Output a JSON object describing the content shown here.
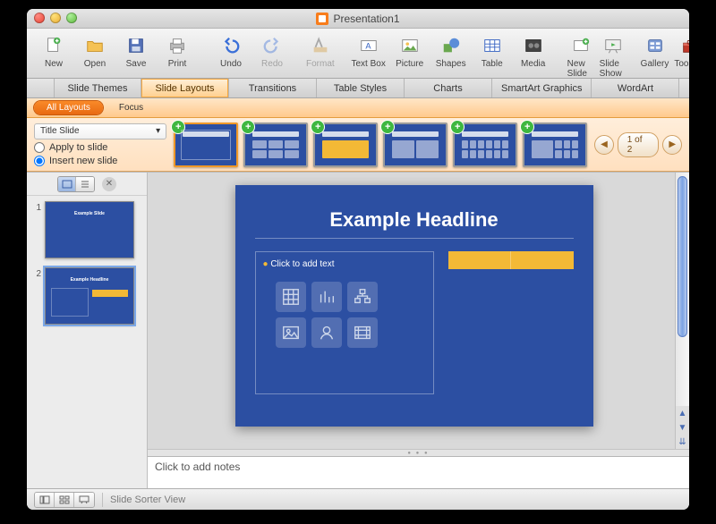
{
  "title": "Presentation1",
  "toolbar": [
    {
      "name": "new",
      "label": "New"
    },
    {
      "name": "open",
      "label": "Open"
    },
    {
      "name": "save",
      "label": "Save"
    },
    {
      "name": "print",
      "label": "Print"
    },
    {
      "name": "undo",
      "label": "Undo"
    },
    {
      "name": "redo",
      "label": "Redo",
      "disabled": true
    },
    {
      "name": "format",
      "label": "Format",
      "disabled": true
    },
    {
      "name": "textbox",
      "label": "Text Box"
    },
    {
      "name": "picture",
      "label": "Picture"
    },
    {
      "name": "shapes",
      "label": "Shapes"
    },
    {
      "name": "table",
      "label": "Table"
    },
    {
      "name": "media",
      "label": "Media"
    },
    {
      "name": "newslide",
      "label": "New Slide"
    },
    {
      "name": "slideshow",
      "label": "Slide Show"
    },
    {
      "name": "gallery",
      "label": "Gallery"
    },
    {
      "name": "toolbox",
      "label": "Toolbox"
    }
  ],
  "ribbon": {
    "tabs": [
      "Slide Themes",
      "Slide Layouts",
      "Transitions",
      "Table Styles",
      "Charts",
      "SmartArt Graphics",
      "WordArt"
    ],
    "active": "Slide Layouts"
  },
  "subtabs": {
    "items": [
      "All Layouts",
      "Focus"
    ],
    "active": "All Layouts"
  },
  "layoutbar": {
    "dropdown": "Title Slide",
    "apply": "Apply to slide",
    "insert": "Insert new slide",
    "pager": "1 of 2"
  },
  "sidebar": {
    "slides": [
      {
        "n": "1",
        "title": "Example Slide"
      },
      {
        "n": "2",
        "title": "Example Headline"
      }
    ]
  },
  "slide": {
    "headline": "Example Headline",
    "placeholder": "Click to add text"
  },
  "notes": "Click to add notes",
  "status": "Slide Sorter View"
}
